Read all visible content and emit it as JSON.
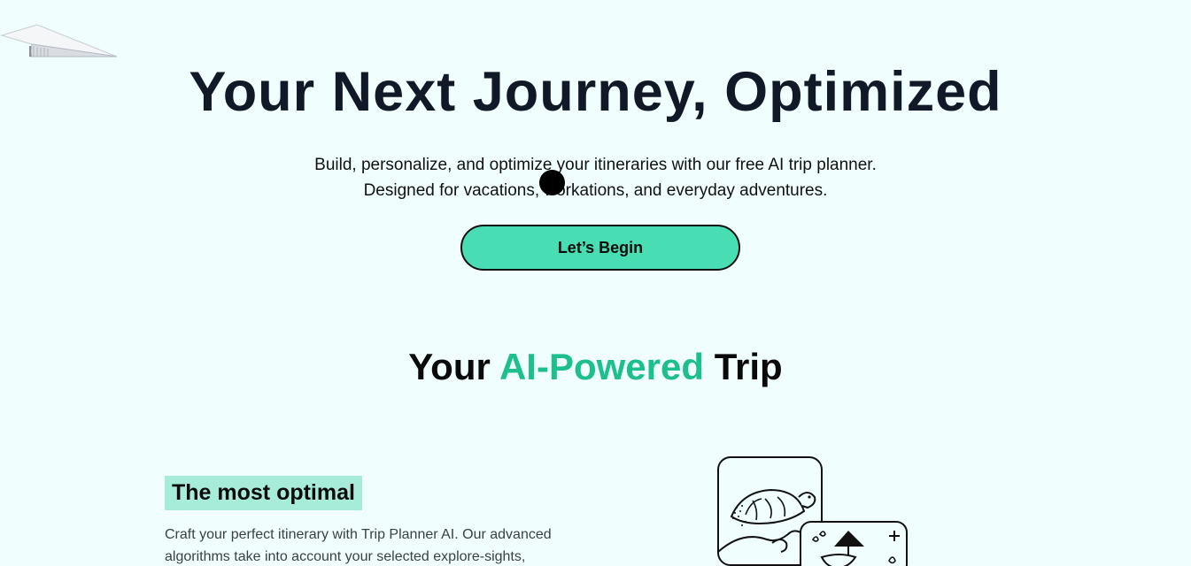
{
  "hero": {
    "title": "Your Next Journey, Optimized",
    "subtitle_line1": "Build, personalize, and optimize your itineraries with our free AI trip planner.",
    "subtitle_line2": "Designed for vacations, workations, and everyday adventures.",
    "cta_label": "Let’s Begin"
  },
  "section": {
    "title_prefix": "Your",
    "title_accent": "AI-Powered",
    "title_suffix": "Trip",
    "accent_color": "#1dbf8c"
  },
  "feature": {
    "tag": "The most optimal",
    "description": "Craft your perfect itinerary with Trip Planner AI. Our advanced algorithms take into account your selected explore-sights,"
  },
  "decor": {
    "plane_icon": "paper-plane-icon",
    "illustration_icon": "travel-illustration-icon",
    "cursor": "cursor-dot"
  },
  "colors": {
    "background": "#f0fffe",
    "cta": "#48ddb2",
    "tag_highlight": "#a7ecd9",
    "title": "#111827"
  }
}
